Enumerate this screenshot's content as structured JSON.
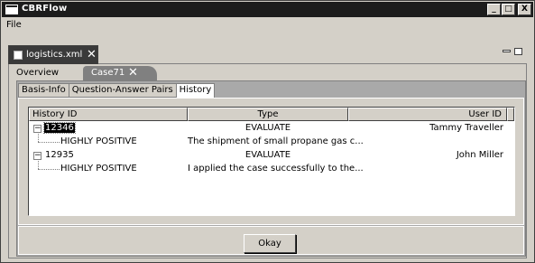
{
  "window": {
    "title": "CBRFlow"
  },
  "window_controls": {
    "minimize": "_",
    "maximize": "□",
    "close": "X"
  },
  "menu": {
    "file": "File"
  },
  "editor": {
    "file_tab_label": "logistics.xml",
    "file_tab_close": "✕"
  },
  "case_tabs": {
    "overview": "Overview",
    "case": "Case71",
    "case_close": "✕"
  },
  "sub_tabs": [
    "Basis-Info",
    "Question-Answer Pairs",
    "History"
  ],
  "table": {
    "columns": [
      "History ID",
      "Type",
      "User ID"
    ],
    "rows": [
      {
        "id": "12346",
        "type": "EVALUATE",
        "user": "Tammy Traveller",
        "expanded": true,
        "selected": true
      },
      {
        "id": "HIGHLY POSITIVE",
        "type": "The shipment of small propane gas c...",
        "user": "",
        "child": true
      },
      {
        "id": "12935",
        "type": "EVALUATE",
        "user": "John Miller",
        "expanded": true
      },
      {
        "id": "HIGHLY POSITIVE",
        "type": "I applied the case successfully to the...",
        "user": "",
        "child": true
      }
    ]
  },
  "buttons": {
    "ok": "Okay"
  }
}
